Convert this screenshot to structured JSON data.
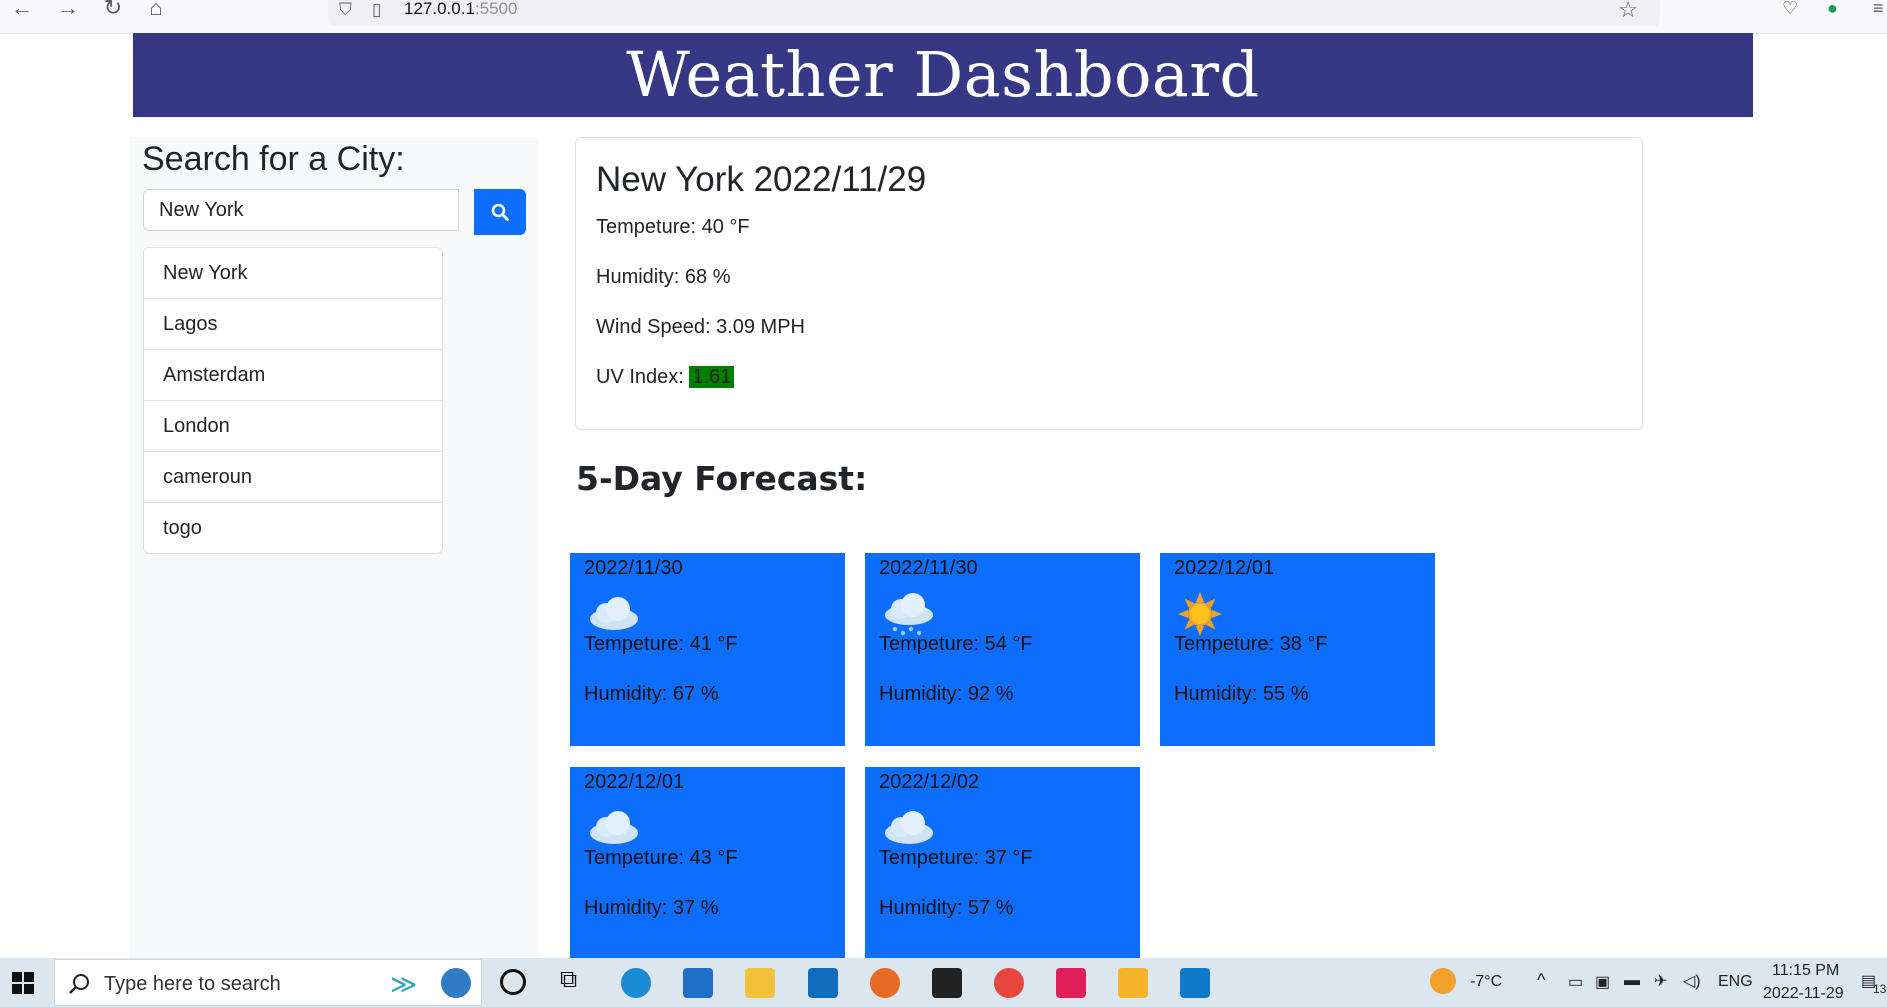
{
  "browser": {
    "url_host": "127.0.0.1",
    "url_port": ":5500"
  },
  "header": {
    "title": "Weather Dashboard"
  },
  "sidebar": {
    "title": "Search for a City:",
    "search_value": "New York",
    "cities": [
      "New York",
      "Lagos",
      "Amsterdam",
      "London",
      "cameroun",
      "togo"
    ]
  },
  "current": {
    "heading": "New York 2022/11/29",
    "temperature": "Tempeture: 40 °F",
    "humidity": "Humidity: 68 %",
    "wind": "Wind Speed: 3.09 MPH",
    "uv_label": "UV Index:",
    "uv_value": "1.61",
    "uv_color": "#008000"
  },
  "forecast": {
    "title": "5-Day Forecast:",
    "card_color": "#0d6efd",
    "days": [
      {
        "date": "2022/11/30",
        "icon": "cloud-icon",
        "temp": "Tempeture: 41 °F",
        "humidity": "Humidity: 67 %"
      },
      {
        "date": "2022/11/30",
        "icon": "rain-cloud-icon",
        "temp": "Tempeture: 54 °F",
        "humidity": "Humidity: 92 %"
      },
      {
        "date": "2022/12/01",
        "icon": "sun-icon",
        "temp": "Tempeture: 38 °F",
        "humidity": "Humidity: 55 %"
      },
      {
        "date": "2022/12/01",
        "icon": "cloud-icon",
        "temp": "Tempeture: 43 °F",
        "humidity": "Humidity: 37 %"
      },
      {
        "date": "2022/12/02",
        "icon": "cloud-icon",
        "temp": "Tempeture: 37 °F",
        "humidity": "Humidity: 57 %"
      }
    ]
  },
  "taskbar": {
    "search_placeholder": "Type here to search",
    "weather": "-7°C",
    "language": "ENG",
    "time": "11:15 PM",
    "date": "2022-11-29",
    "notification_count": "13"
  }
}
